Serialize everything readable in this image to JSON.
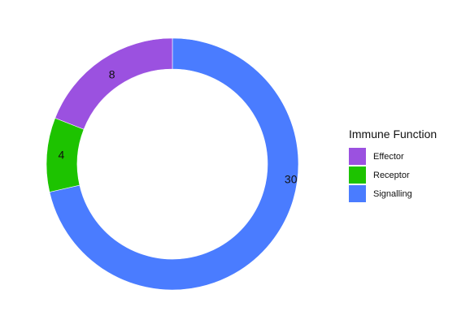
{
  "chart_data": {
    "type": "pie",
    "style": "donut",
    "legend_title": "Immune Function",
    "legend_position": "right",
    "categories": [
      "Effector",
      "Receptor",
      "Signalling"
    ],
    "values": [
      8,
      4,
      30
    ],
    "colors": [
      "#9B51E0",
      "#1DC300",
      "#4A7CFF"
    ]
  }
}
